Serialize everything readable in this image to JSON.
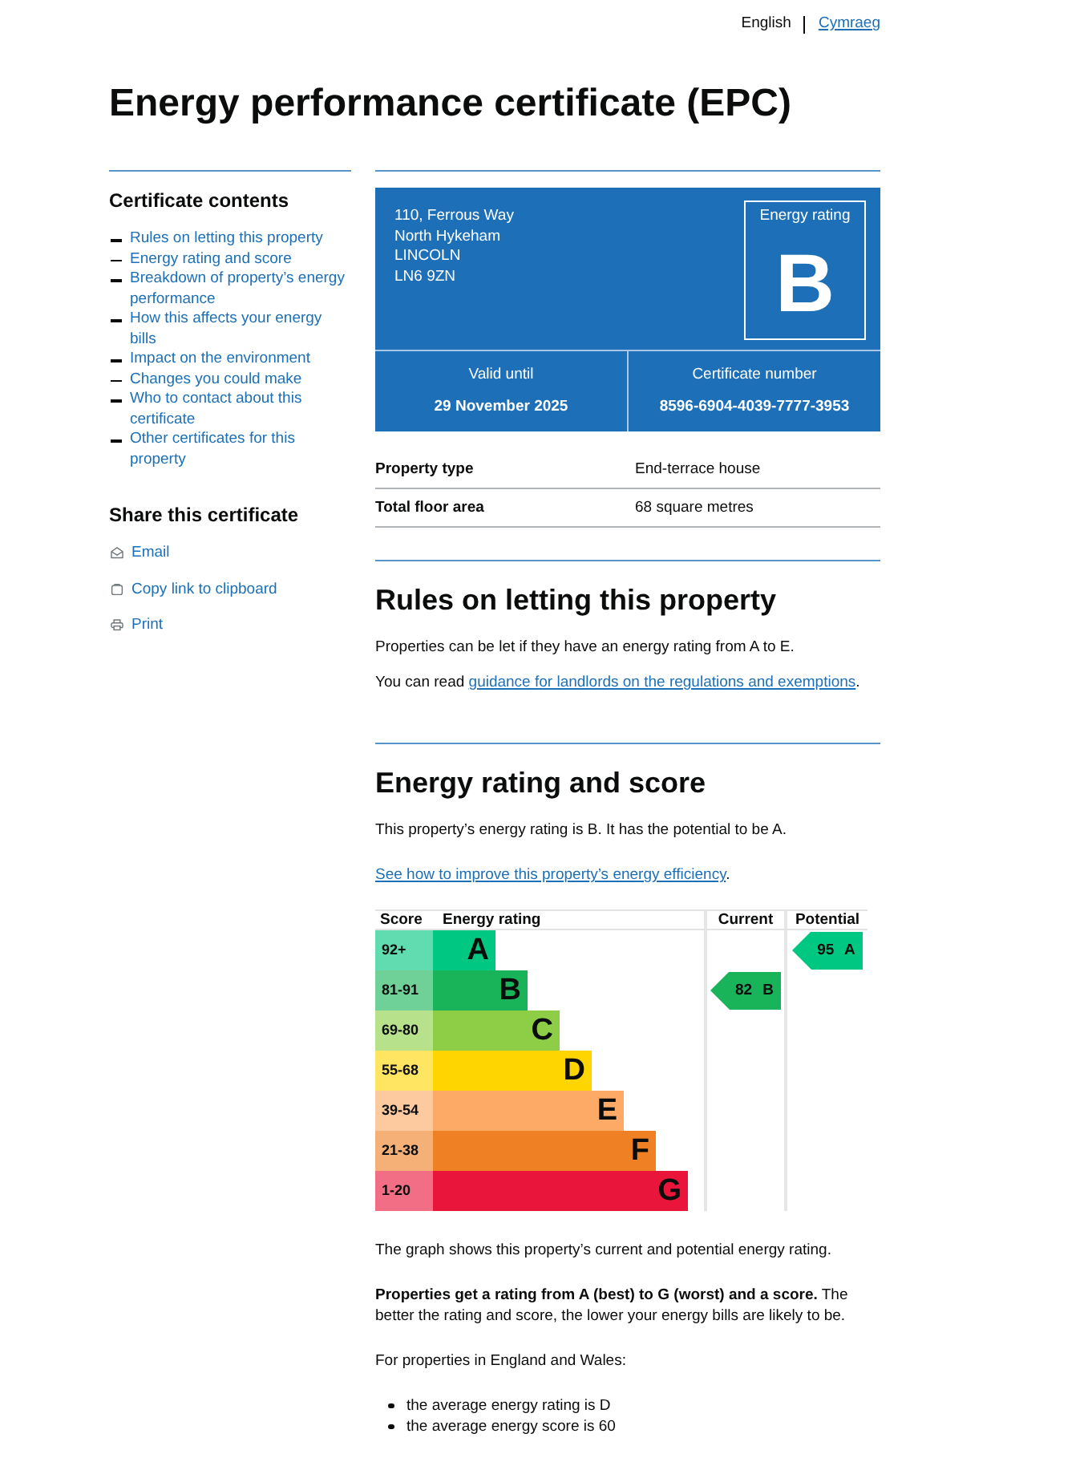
{
  "language_bar": [
    {
      "label": "English",
      "selected": true
    },
    {
      "label": "Cymraeg",
      "selected": false
    }
  ],
  "page_title": "Energy performance certificate (EPC)",
  "sidebar": {
    "contents_title": "Certificate contents",
    "contents": [
      "Rules on letting this property",
      "Energy rating and score",
      "Breakdown of property’s energy performance",
      "How this affects your energy bills",
      "Impact on the environment",
      "Changes you could make",
      "Who to contact about this certificate",
      "Other certificates for this property"
    ],
    "share_title": "Share this certificate",
    "share_links": [
      {
        "kind": "email",
        "label": "Email"
      },
      {
        "kind": "copy",
        "label": "Copy link to clipboard"
      },
      {
        "kind": "print",
        "label": "Print"
      }
    ]
  },
  "certificate": {
    "address": [
      "110, Ferrous Way",
      "North Hykeham",
      "LINCOLN",
      "LN6 9ZN"
    ],
    "rating_label": "Energy rating",
    "rating": "B",
    "valid_until_label": "Valid until",
    "valid_until": "29 November 2025",
    "number_label": "Certificate number",
    "number": "8596-6904-4039-7777-3953"
  },
  "property_summary": [
    {
      "label": "Property type",
      "value": "End-terrace house"
    },
    {
      "label": "Total floor area",
      "value": "68 square metres"
    }
  ],
  "rules_section": {
    "title": "Rules on letting this property",
    "paragraphs": [
      [
        {
          "kind": "text",
          "text": "Properties can be let if they have an energy rating from A to E."
        }
      ],
      [
        {
          "kind": "text",
          "text": "You can read "
        },
        {
          "kind": "link",
          "text": "guidance for landlords on the regulations and exemptions"
        },
        {
          "kind": "text",
          "text": "."
        }
      ]
    ]
  },
  "rating_section": {
    "title": "Energy rating and score",
    "intro_paragraphs": [
      [
        {
          "kind": "text",
          "text": "This property’s energy rating is B. It has the potential to be A."
        }
      ],
      [
        {
          "kind": "link",
          "text": "See how to improve this property’s energy efficiency"
        },
        {
          "kind": "text",
          "text": "."
        }
      ]
    ],
    "rating_chart": {
      "headers": [
        "Score",
        "Energy rating",
        "Current",
        "Potential"
      ],
      "bands": [
        {
          "score": "92+",
          "rating": "A",
          "color": "#00c781",
          "potential": {
            "score": "95",
            "rating": "A"
          }
        },
        {
          "score": "81-91",
          "rating": "B",
          "color": "#19b459",
          "current": {
            "score": "82",
            "rating": "B"
          }
        },
        {
          "score": "69-80",
          "rating": "C",
          "color": "#8dce46"
        },
        {
          "score": "55-68",
          "rating": "D",
          "color": "#ffd500"
        },
        {
          "score": "39-54",
          "rating": "E",
          "color": "#fcaa65"
        },
        {
          "score": "21-38",
          "rating": "F",
          "color": "#ef8023"
        },
        {
          "score": "1-20",
          "rating": "G",
          "color": "#e9153b"
        }
      ]
    },
    "after_paragraphs": [
      [
        {
          "kind": "text",
          "text": "The graph shows this property’s current and potential energy rating."
        }
      ],
      [
        {
          "kind": "text",
          "text": "**Properties get a rating from A (best) to G (worst) and a score.** The better the rating and score, the lower your energy bills are likely to be."
        }
      ],
      [
        {
          "kind": "text",
          "text": "For properties in England and Wales:"
        }
      ]
    ],
    "bullets": [
      "the average energy rating is D",
      "the average energy score is 60"
    ]
  }
}
